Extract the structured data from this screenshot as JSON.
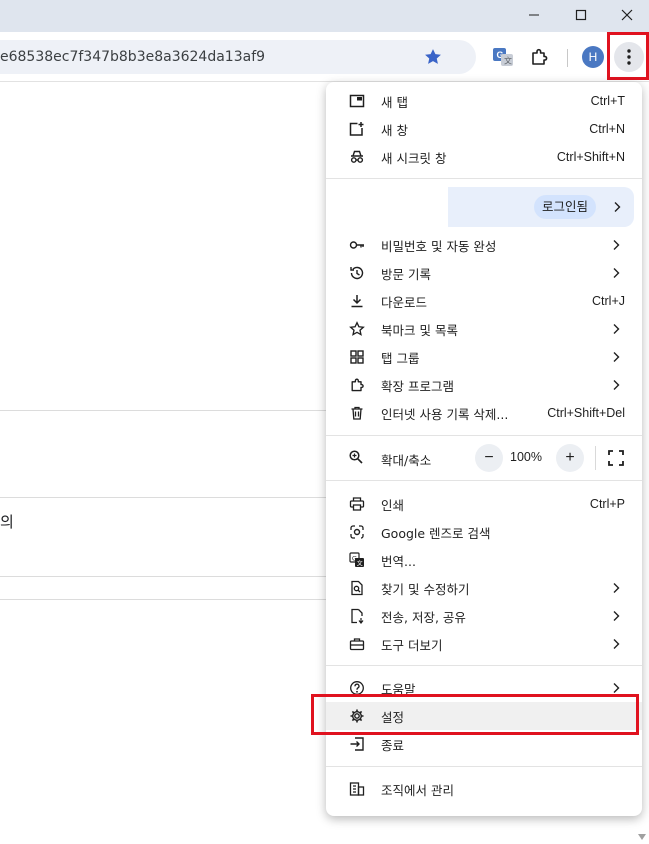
{
  "window": {
    "minimize_icon": "minimize-icon",
    "maximize_icon": "maximize-icon",
    "close_icon": "close-icon"
  },
  "toolbar": {
    "url_text": "e68538ec7f347b8b3e8a3624da13af9",
    "avatar_letter": "H"
  },
  "background": {
    "partial_text": "의"
  },
  "menu": {
    "new_tab": {
      "label": "새 탭",
      "shortcut": "Ctrl+T"
    },
    "new_window": {
      "label": "새 창",
      "shortcut": "Ctrl+N"
    },
    "new_incognito": {
      "label": "새 시크릿 창",
      "shortcut": "Ctrl+Shift+N"
    },
    "signed_in": "로그인됨",
    "passwords": {
      "label": "비밀번호 및 자동 완성"
    },
    "history": {
      "label": "방문 기록"
    },
    "downloads": {
      "label": "다운로드",
      "shortcut": "Ctrl+J"
    },
    "bookmarks": {
      "label": "북마크 및 목록"
    },
    "tab_groups": {
      "label": "탭 그룹"
    },
    "extensions": {
      "label": "확장 프로그램"
    },
    "clear_data": {
      "label": "인터넷 사용 기록 삭제...",
      "shortcut": "Ctrl+Shift+Del"
    },
    "zoom": {
      "label": "확대/축소",
      "minus": "−",
      "value": "100%",
      "plus": "+"
    },
    "print": {
      "label": "인쇄",
      "shortcut": "Ctrl+P"
    },
    "lens": {
      "label": "Google 렌즈로 검색"
    },
    "translate": {
      "label": "번역..."
    },
    "find_edit": {
      "label": "찾기 및 수정하기"
    },
    "cast_save_share": {
      "label": "전송, 저장, 공유"
    },
    "more_tools": {
      "label": "도구 더보기"
    },
    "help": {
      "label": "도움말"
    },
    "settings": {
      "label": "설정"
    },
    "exit": {
      "label": "종료"
    },
    "managed": {
      "label": "조직에서 관리"
    }
  },
  "colors": {
    "highlight": "#e0121f",
    "accent": "#4a78c2",
    "signin_bg": "#e8effb"
  }
}
